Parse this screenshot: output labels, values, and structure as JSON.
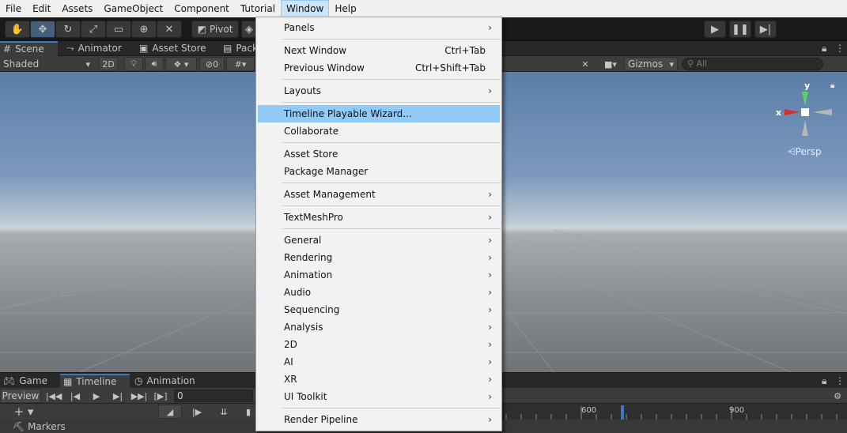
{
  "menubar": {
    "items": [
      "File",
      "Edit",
      "Assets",
      "GameObject",
      "Component",
      "Tutorial",
      "Window",
      "Help"
    ],
    "active": "Window"
  },
  "toolbar": {
    "pivot_label": "Pivot",
    "tools": [
      "hand-tool",
      "move-tool",
      "rotate-tool",
      "scale-tool",
      "rect-tool",
      "transform-tool",
      "custom-tool"
    ]
  },
  "scene_tabs": [
    "Scene",
    "Animator",
    "Asset Store",
    "Pack"
  ],
  "scene_bar": {
    "shading_mode": "Shaded",
    "mode_2d": "2D",
    "hidden_count": "0",
    "gizmos_label": "Gizmos",
    "search_placeholder": "All"
  },
  "viewport": {
    "axis_x": "x",
    "axis_y": "y",
    "projection": "Persp"
  },
  "bottom_tabs": [
    "Game",
    "Timeline",
    "Animation"
  ],
  "timeline": {
    "preview_label": "Preview",
    "frame_value": "0",
    "markers_label": "Markers",
    "ruler_labels": [
      "600",
      "900"
    ]
  },
  "window_menu": {
    "items": [
      {
        "label": "Panels",
        "submenu": true
      },
      {
        "label": "Next Window",
        "shortcut": "Ctrl+Tab"
      },
      {
        "label": "Previous Window",
        "shortcut": "Ctrl+Shift+Tab"
      },
      {
        "label": "Layouts",
        "submenu": true
      },
      {
        "label": "Timeline Playable Wizard...",
        "highlighted": true
      },
      {
        "label": "Collaborate"
      },
      {
        "label": "Asset Store"
      },
      {
        "label": "Package Manager"
      },
      {
        "label": "Asset Management",
        "submenu": true
      },
      {
        "label": "TextMeshPro",
        "submenu": true
      },
      {
        "label": "General",
        "submenu": true
      },
      {
        "label": "Rendering",
        "submenu": true
      },
      {
        "label": "Animation",
        "submenu": true
      },
      {
        "label": "Audio",
        "submenu": true
      },
      {
        "label": "Sequencing",
        "submenu": true
      },
      {
        "label": "Analysis",
        "submenu": true
      },
      {
        "label": "2D",
        "submenu": true
      },
      {
        "label": "AI",
        "submenu": true
      },
      {
        "label": "XR",
        "submenu": true
      },
      {
        "label": "UI Toolkit",
        "submenu": true
      },
      {
        "label": "Render Pipeline",
        "submenu": true
      }
    ],
    "submenu_arrow": "›"
  },
  "colors": {
    "highlight": "#91c9f7",
    "menu_bg": "#f2f2f2",
    "editor_dark": "#191919",
    "panel": "#3c3c3c",
    "accent_tab": "#3a79bb"
  }
}
